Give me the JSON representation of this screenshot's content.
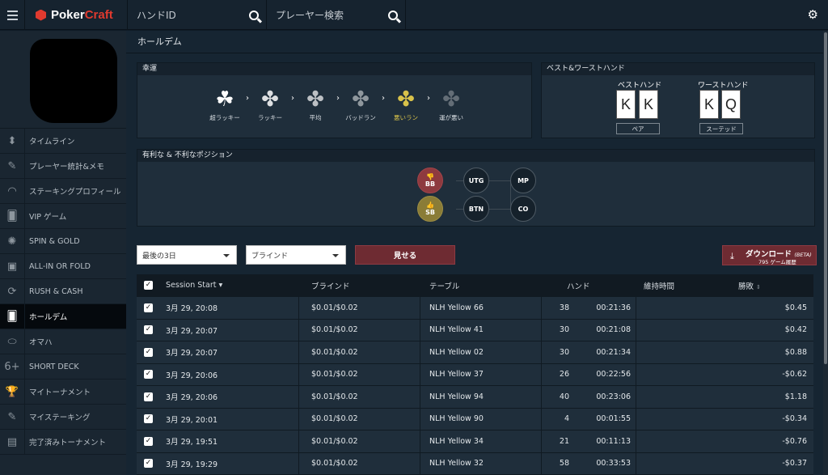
{
  "topbar": {
    "logo_part1": "Poker",
    "logo_part2": "Craft",
    "hand_id_placeholder": "ハンドID",
    "player_search_placeholder": "プレーヤー検索"
  },
  "sidebar": {
    "items": [
      {
        "label": "タイムライン",
        "icon": "timeline-icon"
      },
      {
        "label": "プレーヤー統計&メモ",
        "icon": "player-stats-icon"
      },
      {
        "label": "ステーキングプロフィール",
        "icon": "gauge-icon"
      },
      {
        "label": "VIP ゲーム",
        "icon": "cards-icon"
      },
      {
        "label": "SPIN & GOLD",
        "icon": "spin-icon"
      },
      {
        "label": "ALL-IN OR FOLD",
        "icon": "all-in-icon"
      },
      {
        "label": "RUSH & CASH",
        "icon": "rush-icon"
      },
      {
        "label": "ホールデム",
        "icon": "holdem-icon"
      },
      {
        "label": "オマハ",
        "icon": "omaha-icon"
      },
      {
        "label": "SHORT DECK",
        "icon": "short-deck-icon"
      },
      {
        "label": "マイトーナメント",
        "icon": "trophy-icon"
      },
      {
        "label": "マイステーキング",
        "icon": "staking-icon"
      },
      {
        "label": "完了済みトーナメント",
        "icon": "completed-tournament-icon"
      }
    ],
    "active_index": 7
  },
  "page": {
    "title": "ホールデム"
  },
  "luck": {
    "heading": "幸運",
    "levels": [
      {
        "label": "超ラッキー"
      },
      {
        "label": "ラッキー"
      },
      {
        "label": "平均"
      },
      {
        "label": "バッドラン"
      },
      {
        "label": "悪いラン"
      },
      {
        "label": "運が悪い"
      }
    ],
    "selected_index": 4,
    "highlight_color": "#d8c24a"
  },
  "best_worst": {
    "heading": "ベスト&ワーストハンド",
    "best_label": "ベストハンド",
    "best_cards": [
      "K",
      "K"
    ],
    "best_tag": "ペア",
    "worst_label": "ワーストハンド",
    "worst_cards": [
      "K",
      "Q"
    ],
    "worst_tag": "スーテッド"
  },
  "positions": {
    "heading": "有利な & 不利なポジション",
    "items": {
      "bb": "BB",
      "utg": "UTG",
      "mp": "MP",
      "sb": "SB",
      "btn": "BTN",
      "co": "CO"
    }
  },
  "filters": {
    "period": "最後の3日",
    "blinds": "ブラインド",
    "show_button": "見せる",
    "download_label": "ダウンロード",
    "download_beta": "(BETA)",
    "download_sub": "795 ゲーム履歴"
  },
  "table": {
    "headers": {
      "session_start": "Session Start",
      "blinds": "ブラインド",
      "table": "テーブル",
      "hands": "ハンド",
      "duration": "維持時間",
      "result": "勝敗"
    },
    "rows": [
      {
        "date": "3月 29, 20:08",
        "blinds": "$0.01/$0.02",
        "table": "NLH Yellow 66",
        "hands": "38",
        "duration": "00:21:36",
        "result": "$0.45"
      },
      {
        "date": "3月 29, 20:07",
        "blinds": "$0.01/$0.02",
        "table": "NLH Yellow 41",
        "hands": "30",
        "duration": "00:21:08",
        "result": "$0.42"
      },
      {
        "date": "3月 29, 20:07",
        "blinds": "$0.01/$0.02",
        "table": "NLH Yellow 02",
        "hands": "30",
        "duration": "00:21:34",
        "result": "$0.88"
      },
      {
        "date": "3月 29, 20:06",
        "blinds": "$0.01/$0.02",
        "table": "NLH Yellow 37",
        "hands": "26",
        "duration": "00:22:56",
        "result": "-$0.62"
      },
      {
        "date": "3月 29, 20:06",
        "blinds": "$0.01/$0.02",
        "table": "NLH Yellow 94",
        "hands": "40",
        "duration": "00:23:06",
        "result": "$1.18"
      },
      {
        "date": "3月 29, 20:01",
        "blinds": "$0.01/$0.02",
        "table": "NLH Yellow 90",
        "hands": "4",
        "duration": "00:01:55",
        "result": "-$0.34"
      },
      {
        "date": "3月 29, 19:51",
        "blinds": "$0.01/$0.02",
        "table": "NLH Yellow 34",
        "hands": "21",
        "duration": "00:11:13",
        "result": "-$0.76"
      },
      {
        "date": "3月 29, 19:29",
        "blinds": "$0.01/$0.02",
        "table": "NLH Yellow 32",
        "hands": "58",
        "duration": "00:33:53",
        "result": "-$0.37"
      }
    ]
  }
}
